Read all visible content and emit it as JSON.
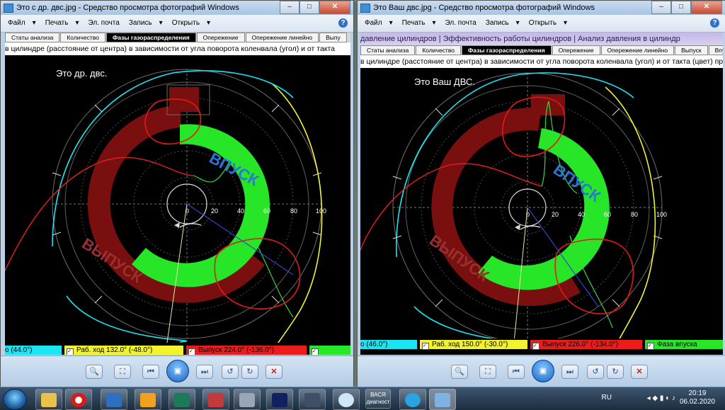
{
  "left": {
    "title": "Это с др. двс.jpg - Средство просмотра фотографий Windows",
    "menu": [
      "Файл",
      "Печать",
      "Эл. почта",
      "Запись",
      "Открыть"
    ],
    "tabs": [
      "Статы анализа",
      "Количество",
      "Фазы газораспределения",
      "Опережение",
      "Опережение линейно",
      "Выпу"
    ],
    "active_tab": 2,
    "description": "в цилиндре (расстояние от центра) в зависимости от угла поворота коленвала (угол) и от такта",
    "note": "Это др. двс.",
    "label_intake": "ВПУСК",
    "label_exhaust": "ВЫПУСК",
    "axis_ticks": [
      "0",
      "20",
      "40",
      "60",
      "80",
      "100"
    ],
    "legend": [
      {
        "text": "о (44.0°)",
        "color": "#19e6f2"
      },
      {
        "text": "Раб. ход 132.0° (-48.0°)",
        "color": "#f3f32d"
      },
      {
        "text": "Выпуск 224.0° (-136.0°)",
        "color": "#ee1b1b"
      },
      {
        "text": "",
        "color": "#28e628"
      }
    ]
  },
  "right": {
    "title": "Это Ваш двс.jpg - Средство просмотра фотографий Windows",
    "menu": [
      "Файл",
      "Печать",
      "Эл. почта",
      "Запись",
      "Открыть"
    ],
    "top_strip": "давление цилиндров | Эффективность работы цилиндров | Анализ давления в цилиндр",
    "tabs": [
      "Статы анализа",
      "Количество",
      "Фазы газораспределения",
      "Опережение",
      "Опережение линейно",
      "Выпуск",
      "Впуск"
    ],
    "active_tab": 2,
    "description": "в цилиндре (расстояние от центра) в зависимости от угла поворота коленвала (угол) и от такта (цвет) при",
    "note": "Это Ваш ДВС.",
    "label_intake": "ВПУСК",
    "label_exhaust": "ВЫПУСК",
    "axis_ticks": [
      "0",
      "20",
      "40",
      "60",
      "80",
      "100"
    ],
    "legend": [
      {
        "text": "о (46.0°)",
        "color": "#19e6f2"
      },
      {
        "text": "Раб. ход 150.0° (-30.0°)",
        "color": "#f3f32d"
      },
      {
        "text": "Выпуск 226.0° (-134.0°)",
        "color": "#ee1b1b"
      },
      {
        "text": "Фаза впуска",
        "color": "#28e628"
      }
    ]
  },
  "window_buttons": {
    "minimize": "–",
    "maximize": "□",
    "close": "✕"
  },
  "help": "?",
  "taskbar": {
    "lang": "RU",
    "time": "20:19",
    "date": "06.02.2020",
    "vasya": "ВАСЯ диагност"
  }
}
